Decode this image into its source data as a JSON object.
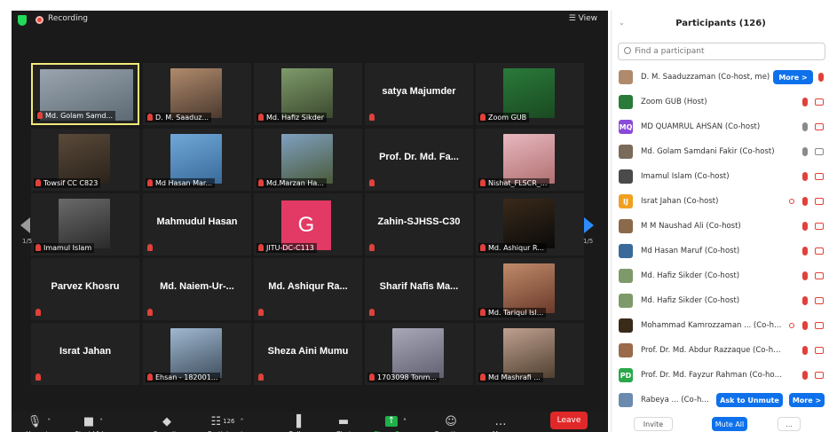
{
  "meeting": {
    "recording_label": "Recording",
    "view_label": "View",
    "page_left": "1/5",
    "page_right": "1/5",
    "tiles": [
      {
        "label": "Md. Golam Samd...",
        "has_video": true,
        "active": true,
        "colors": [
          "#9aa4ae",
          "#5c6a74"
        ]
      },
      {
        "label": "D. M. Saaduz...",
        "has_video": true,
        "colors": [
          "#b08a6c",
          "#4b3a2f"
        ]
      },
      {
        "label": "Md. Hafiz Sikder",
        "has_video": true,
        "colors": [
          "#7f9a6a",
          "#3b4a2f"
        ]
      },
      {
        "name": "satya Majumder",
        "has_video": false
      },
      {
        "label": "Zoom GUB",
        "has_video": true,
        "colors": [
          "#2a7a3a",
          "#1a4a22"
        ]
      },
      {
        "label": "Towsif CC C823",
        "has_video": true,
        "colors": [
          "#5a4a3a",
          "#2a221a"
        ]
      },
      {
        "label": "Md Hasan Mar...",
        "has_video": true,
        "colors": [
          "#6fa8d8",
          "#3a6a9a"
        ]
      },
      {
        "label": "Md.Marzan Ha...",
        "has_video": true,
        "colors": [
          "#7fa0c0",
          "#4a5a3a"
        ]
      },
      {
        "name": "Prof. Dr. Md. Fa...",
        "has_video": false
      },
      {
        "label": "Nishat_FLSCR_...",
        "has_video": true,
        "colors": [
          "#e8b8c0",
          "#b07070"
        ]
      },
      {
        "label": "Imamul Islam",
        "has_video": true,
        "colors": [
          "#6a6a6a",
          "#2a2a2a"
        ]
      },
      {
        "name": "Mahmudul Hasan",
        "has_video": false
      },
      {
        "label": "JITU-DC-C113",
        "avatar_letter": "G",
        "has_video": false
      },
      {
        "name": "Zahin-SJHSS-C30",
        "has_video": false
      },
      {
        "label": "Md. Ashiqur R...",
        "has_video": true,
        "colors": [
          "#3a2a1a",
          "#0a0a0a"
        ]
      },
      {
        "name": "Parvez Khosru",
        "has_video": false
      },
      {
        "name": "Md.  Naiem-Ur-...",
        "has_video": false
      },
      {
        "name": "Md.  Ashiqur Ra...",
        "has_video": false
      },
      {
        "name": "Sharif  Nafis Ma...",
        "has_video": false
      },
      {
        "label": "Md. Tariqul Isl...",
        "has_video": true,
        "colors": [
          "#c08a6a",
          "#6a3a2a"
        ]
      },
      {
        "name": "Israt Jahan",
        "has_video": false
      },
      {
        "label": "Ehsan - 182001...",
        "has_video": true,
        "colors": [
          "#a0b8d0",
          "#405060"
        ]
      },
      {
        "name": "Sheza Aini Mumu",
        "has_video": false
      },
      {
        "label": "1703098 Tonm...",
        "has_video": true,
        "colors": [
          "#a8a8b8",
          "#606070"
        ]
      },
      {
        "label": "Md Mashrafi ...",
        "has_video": true,
        "colors": [
          "#c0a090",
          "#504030"
        ]
      }
    ],
    "toolbar": [
      {
        "icon": "mic-muted-icon",
        "glyph": "🎙",
        "label": "Unmute",
        "caret": true
      },
      {
        "icon": "video-off-icon",
        "glyph": "■",
        "label": "Start Video",
        "caret": true
      },
      {
        "icon": "shield-security-icon",
        "glyph": "◆",
        "label": "Security"
      },
      {
        "icon": "participants-icon",
        "glyph": "☷",
        "label": "Participants",
        "count": "126",
        "caret": true
      },
      {
        "icon": "polls-icon",
        "glyph": "▐",
        "label": "Polls"
      },
      {
        "icon": "chat-icon",
        "glyph": "▬",
        "label": "Chat"
      },
      {
        "icon": "share-screen-icon",
        "glyph": "↑",
        "label": "Share Screen",
        "caret": true,
        "green": true
      },
      {
        "icon": "reactions-icon",
        "glyph": "☺",
        "label": "Reactions"
      },
      {
        "icon": "more-icon",
        "glyph": "…",
        "label": "More"
      }
    ],
    "leave_label": "Leave"
  },
  "participants": {
    "title": "Participants (126)",
    "search_placeholder": "Find a participant",
    "rows": [
      {
        "name": "D. M. Saaduzzaman (Co-host, me)",
        "avatar": "#b08a6c",
        "more": "More >",
        "mic": "red"
      },
      {
        "name": "Zoom GUB (Host)",
        "avatar": "#2a7a3a",
        "mic": "red",
        "cam": "red"
      },
      {
        "name": "MD QUAMRUL AHSAN (Co-host)",
        "avatar": "#8a4ad8",
        "initials": "MQ",
        "mic": "gray",
        "cam": "red"
      },
      {
        "name": "Md. Golam Samdani Fakir (Co-host)",
        "avatar": "#7a6a5a",
        "mic": "gray",
        "cam": "gray"
      },
      {
        "name": "Imamul Islam (Co-host)",
        "avatar": "#4a4a4a",
        "mic": "red",
        "cam": "red"
      },
      {
        "name": "Israt Jahan (Co-host)",
        "avatar": "#f0a020",
        "initials": "IJ",
        "raise": true,
        "mic": "red",
        "cam": "red"
      },
      {
        "name": "M M Naushad Ali (Co-host)",
        "avatar": "#8a6a4a",
        "mic": "red",
        "cam": "red"
      },
      {
        "name": "Md Hasan Maruf (Co-host)",
        "avatar": "#3a6a9a",
        "mic": "red",
        "cam": "red"
      },
      {
        "name": "Md. Hafiz Sikder (Co-host)",
        "avatar": "#7f9a6a",
        "mic": "red",
        "cam": "red"
      },
      {
        "name": "Md. Hafiz Sikder (Co-host)",
        "avatar": "#7f9a6a",
        "mic": "red",
        "cam": "red"
      },
      {
        "name": "Mohammad Kamrozzaman ... (Co-host)",
        "avatar": "#3a2a1a",
        "raise": true,
        "mic": "red",
        "cam": "red"
      },
      {
        "name": "Prof. Dr. Md. Abdur Razzaque (Co-host)",
        "avatar": "#9a6a4a",
        "mic": "red",
        "cam": "red"
      },
      {
        "name": "Prof. Dr. Md. Fayzur Rahman (Co-host)",
        "avatar": "#2aa84a",
        "initials": "PD",
        "mic": "red",
        "cam": "red"
      },
      {
        "name": "Rabeya ... (Co-host)",
        "avatar": "#6a8ab0",
        "ask": "Ask to Unmute",
        "more": "More >"
      }
    ],
    "footer": {
      "invite": "Invite",
      "mute_all": "Mute All",
      "more": "..."
    }
  }
}
